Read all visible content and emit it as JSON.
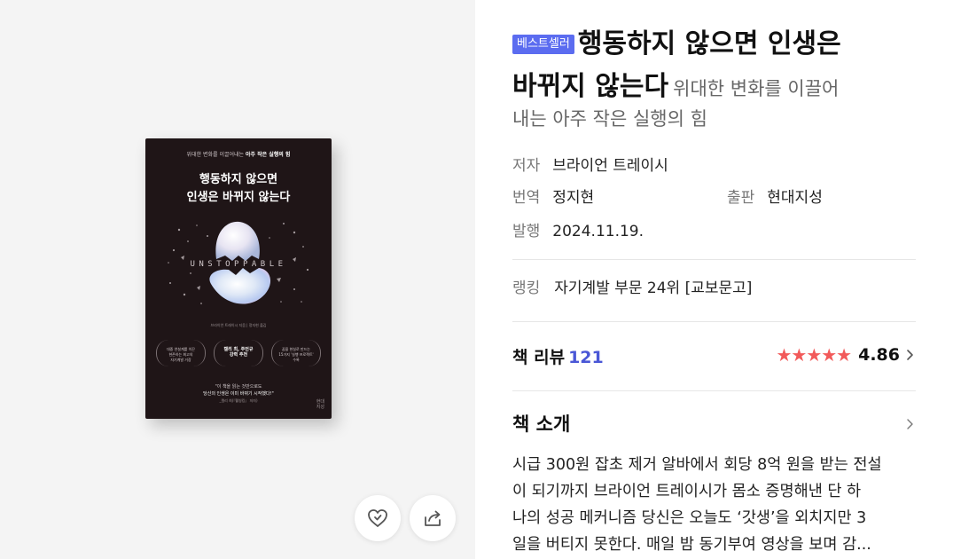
{
  "cover": {
    "subtitle_prefix": "위대한 변화를 이끌어내는 ",
    "subtitle_bold": "아주 작은 실행의 힘",
    "title_line1": "행동하지 않으면",
    "title_line2": "인생은 바뀌지 않는다",
    "english_title": "UNSTOPPABLE",
    "author_line": "브라이언 트레이시 지음 | 정지현 옮김",
    "badge1": [
      "대중 연설계를 이끈",
      "현존하는 최고의",
      "자기계발 거장"
    ],
    "badge2": [
      "켈리 최, 주언규",
      "강력 추천"
    ],
    "badge3": [
      "꿈을 현실로 만드는",
      "15가지 '실행 프로젝트'",
      "수록"
    ],
    "quote_line1": "\"이 책을 읽는 것만으로도",
    "quote_line2": "당신의 인생은 이미 바뀌기 시작했다!\"",
    "quote_line3": "_켈리 최(『웰씽킹』 저자)",
    "publisher_mark": [
      "현대",
      "지성"
    ]
  },
  "actions": {
    "like_icon": "heart-icon",
    "share_icon": "share-icon"
  },
  "book": {
    "badge": "베스트셀러",
    "title_line1": "행동하지 않으면 인생은",
    "title_line2": "바뀌지 않는다",
    "subtitle_part1": "위대한 변화를 이끌어",
    "subtitle_part2": "내는 아주 작은 실행의 힘",
    "author_label": "저자",
    "author": "브라이언 트레이시",
    "translator_label": "번역",
    "translator": "정지현",
    "publisher_label": "출판",
    "publisher": "현대지성",
    "date_label": "발행",
    "date": "2024.11.19.",
    "ranking_label": "랭킹",
    "ranking": "자기계발 부문 24위 [교보문고]"
  },
  "review": {
    "title": "책 리뷰",
    "count": "121",
    "stars": "★★★★★",
    "rating": "4.86",
    "rating_value": 4.86,
    "star_color": "#f25a5a"
  },
  "intro": {
    "title": "책 소개",
    "lines": [
      "시급 300원 잡초 제거 알바에서 회당 8억 원을 받는 전설",
      "이 되기까지 브라이언 트레이시가 몸소 증명해낸 단 하",
      "나의 성공 메커니즘 당신은 오늘도 ‘갓생’을 외치지만 3",
      "일을 버티지 못한다. 매일 밤 동기부여 영상을 보며 감..."
    ]
  },
  "colors": {
    "badge_bg": "#5b6cf0",
    "review_count": "#4a57d6",
    "left_panel_bg": "#f4f4f4"
  }
}
